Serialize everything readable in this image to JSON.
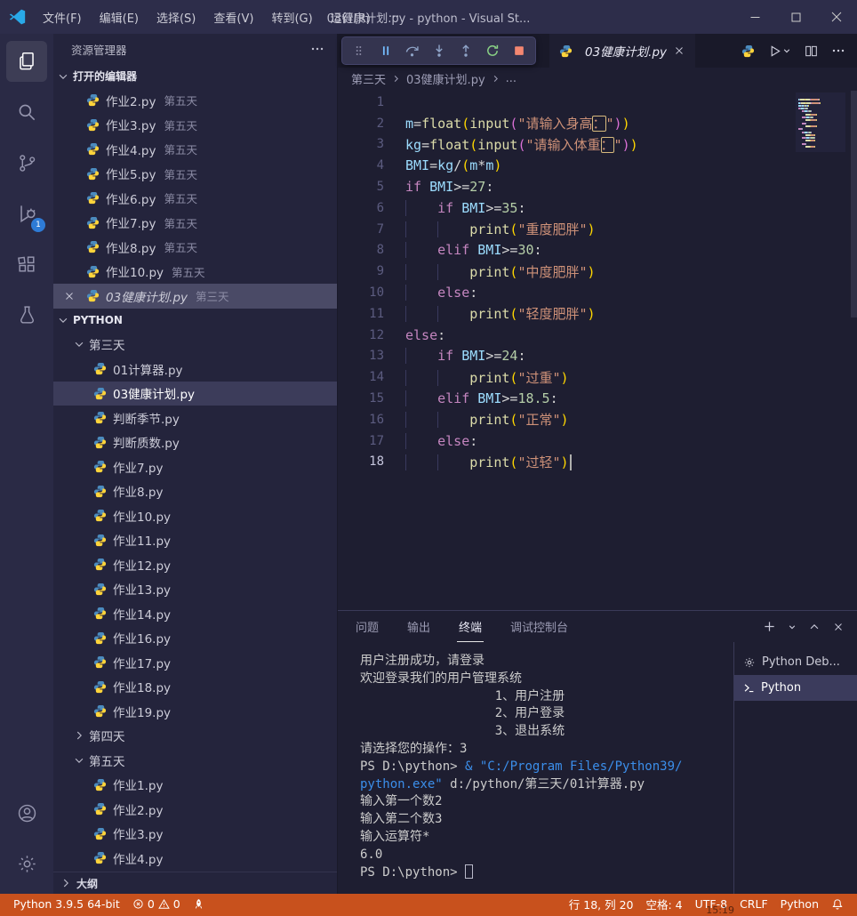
{
  "titlebar": {
    "menus": [
      "文件(F)",
      "编辑(E)",
      "选择(S)",
      "查看(V)",
      "转到(G)",
      "运行(R)",
      "···"
    ],
    "title": "03健康计划.py - python - Visual St..."
  },
  "activity": {
    "debug_badge": "1"
  },
  "sidebar": {
    "header": "资源管理器",
    "open_editors_label": "打开的编辑器",
    "open_editors": [
      {
        "name": "作业2.py",
        "tag": "第五天"
      },
      {
        "name": "作业3.py",
        "tag": "第五天"
      },
      {
        "name": "作业4.py",
        "tag": "第五天"
      },
      {
        "name": "作业5.py",
        "tag": "第五天"
      },
      {
        "name": "作业6.py",
        "tag": "第五天"
      },
      {
        "name": "作业7.py",
        "tag": "第五天"
      },
      {
        "name": "作业8.py",
        "tag": "第五天"
      },
      {
        "name": "作业10.py",
        "tag": "第五天"
      },
      {
        "name": "03健康计划.py",
        "tag": "第三天",
        "active": true
      }
    ],
    "project_label": "PYTHON",
    "tree": [
      {
        "label": "第三天",
        "type": "folder",
        "expanded": true
      },
      {
        "label": "01计算器.py",
        "type": "file"
      },
      {
        "label": "03健康计划.py",
        "type": "file",
        "selected": true
      },
      {
        "label": "判断季节.py",
        "type": "file"
      },
      {
        "label": "判断质数.py",
        "type": "file"
      },
      {
        "label": "作业7.py",
        "type": "file"
      },
      {
        "label": "作业8.py",
        "type": "file"
      },
      {
        "label": "作业10.py",
        "type": "file"
      },
      {
        "label": "作业11.py",
        "type": "file"
      },
      {
        "label": "作业12.py",
        "type": "file"
      },
      {
        "label": "作业13.py",
        "type": "file"
      },
      {
        "label": "作业14.py",
        "type": "file"
      },
      {
        "label": "作业16.py",
        "type": "file"
      },
      {
        "label": "作业17.py",
        "type": "file"
      },
      {
        "label": "作业18.py",
        "type": "file"
      },
      {
        "label": "作业19.py",
        "type": "file"
      },
      {
        "label": "第四天",
        "type": "folder",
        "expanded": false
      },
      {
        "label": "第五天",
        "type": "folder",
        "expanded": true
      },
      {
        "label": "作业1.py",
        "type": "file"
      },
      {
        "label": "作业2.py",
        "type": "file"
      },
      {
        "label": "作业3.py",
        "type": "file"
      },
      {
        "label": "作业4.py",
        "type": "file"
      }
    ],
    "outline_label": "大纲"
  },
  "editor": {
    "tab_label": "03健康计划.py",
    "breadcrumbs": [
      "第三天",
      "03健康计划.py",
      "..."
    ],
    "code_lines": [
      {
        "n": 1,
        "segs": []
      },
      {
        "n": 2,
        "segs": [
          {
            "t": "m",
            "c": "v"
          },
          {
            "t": "=",
            "c": "o"
          },
          {
            "t": "float",
            "c": "f"
          },
          {
            "t": "(",
            "c": "p1"
          },
          {
            "t": "input",
            "c": "f"
          },
          {
            "t": "(",
            "c": "p2"
          },
          {
            "t": "\"请输入身高",
            "c": "s"
          },
          {
            "t": "：",
            "c": "s sbox"
          },
          {
            "t": "\"",
            "c": "s"
          },
          {
            "t": ")",
            "c": "p2"
          },
          {
            "t": ")",
            "c": "p1"
          }
        ]
      },
      {
        "n": 3,
        "segs": [
          {
            "t": "kg",
            "c": "v"
          },
          {
            "t": "=",
            "c": "o"
          },
          {
            "t": "float",
            "c": "f"
          },
          {
            "t": "(",
            "c": "p1"
          },
          {
            "t": "input",
            "c": "f"
          },
          {
            "t": "(",
            "c": "p2"
          },
          {
            "t": "\"请输入体重",
            "c": "s"
          },
          {
            "t": "：",
            "c": "s sbox"
          },
          {
            "t": "\"",
            "c": "s"
          },
          {
            "t": ")",
            "c": "p2"
          },
          {
            "t": ")",
            "c": "p1"
          }
        ]
      },
      {
        "n": 4,
        "segs": [
          {
            "t": "BMI",
            "c": "v"
          },
          {
            "t": "=",
            "c": "o"
          },
          {
            "t": "kg",
            "c": "v"
          },
          {
            "t": "/",
            "c": "o"
          },
          {
            "t": "(",
            "c": "p1"
          },
          {
            "t": "m",
            "c": "v"
          },
          {
            "t": "*",
            "c": "o"
          },
          {
            "t": "m",
            "c": "v"
          },
          {
            "t": ")",
            "c": "p1"
          }
        ]
      },
      {
        "n": 5,
        "segs": [
          {
            "t": "if",
            "c": "k"
          },
          {
            "t": " "
          },
          {
            "t": "BMI",
            "c": "v"
          },
          {
            "t": ">=",
            "c": "o"
          },
          {
            "t": "27",
            "c": "n"
          },
          {
            "t": ":",
            "c": "o"
          }
        ]
      },
      {
        "n": 6,
        "segs": [
          {
            "t": "    ",
            "c": "ind"
          },
          {
            "t": "if",
            "c": "k"
          },
          {
            "t": " "
          },
          {
            "t": "BMI",
            "c": "v"
          },
          {
            "t": ">=",
            "c": "o"
          },
          {
            "t": "35",
            "c": "n"
          },
          {
            "t": ":",
            "c": "o"
          }
        ]
      },
      {
        "n": 7,
        "segs": [
          {
            "t": "    ",
            "c": "ind"
          },
          {
            "t": "    ",
            "c": "ind"
          },
          {
            "t": "print",
            "c": "f"
          },
          {
            "t": "(",
            "c": "p1"
          },
          {
            "t": "\"重度肥胖\"",
            "c": "s"
          },
          {
            "t": ")",
            "c": "p1"
          }
        ]
      },
      {
        "n": 8,
        "segs": [
          {
            "t": "    ",
            "c": "ind"
          },
          {
            "t": "elif",
            "c": "k"
          },
          {
            "t": " "
          },
          {
            "t": "BMI",
            "c": "v"
          },
          {
            "t": ">=",
            "c": "o"
          },
          {
            "t": "30",
            "c": "n"
          },
          {
            "t": ":",
            "c": "o"
          }
        ]
      },
      {
        "n": 9,
        "segs": [
          {
            "t": "    ",
            "c": "ind"
          },
          {
            "t": "    ",
            "c": "ind"
          },
          {
            "t": "print",
            "c": "f"
          },
          {
            "t": "(",
            "c": "p1"
          },
          {
            "t": "\"中度肥胖\"",
            "c": "s"
          },
          {
            "t": ")",
            "c": "p1"
          }
        ]
      },
      {
        "n": 10,
        "segs": [
          {
            "t": "    ",
            "c": "ind"
          },
          {
            "t": "else",
            "c": "k"
          },
          {
            "t": ":",
            "c": "o"
          }
        ]
      },
      {
        "n": 11,
        "segs": [
          {
            "t": "    ",
            "c": "ind"
          },
          {
            "t": "    ",
            "c": "ind"
          },
          {
            "t": "print",
            "c": "f"
          },
          {
            "t": "(",
            "c": "p1"
          },
          {
            "t": "\"轻度肥胖\"",
            "c": "s"
          },
          {
            "t": ")",
            "c": "p1"
          }
        ]
      },
      {
        "n": 12,
        "segs": [
          {
            "t": "else",
            "c": "k"
          },
          {
            "t": ":",
            "c": "o"
          }
        ]
      },
      {
        "n": 13,
        "segs": [
          {
            "t": "    ",
            "c": "ind"
          },
          {
            "t": "if",
            "c": "k"
          },
          {
            "t": " "
          },
          {
            "t": "BMI",
            "c": "v"
          },
          {
            "t": ">=",
            "c": "o"
          },
          {
            "t": "24",
            "c": "n"
          },
          {
            "t": ":",
            "c": "o"
          }
        ]
      },
      {
        "n": 14,
        "segs": [
          {
            "t": "    ",
            "c": "ind"
          },
          {
            "t": "    ",
            "c": "ind"
          },
          {
            "t": "print",
            "c": "f"
          },
          {
            "t": "(",
            "c": "p1"
          },
          {
            "t": "\"过重\"",
            "c": "s"
          },
          {
            "t": ")",
            "c": "p1"
          }
        ]
      },
      {
        "n": 15,
        "segs": [
          {
            "t": "    ",
            "c": "ind"
          },
          {
            "t": "elif",
            "c": "k"
          },
          {
            "t": " "
          },
          {
            "t": "BMI",
            "c": "v"
          },
          {
            "t": ">=",
            "c": "o"
          },
          {
            "t": "18.5",
            "c": "n"
          },
          {
            "t": ":",
            "c": "o"
          }
        ]
      },
      {
        "n": 16,
        "segs": [
          {
            "t": "    ",
            "c": "ind"
          },
          {
            "t": "    ",
            "c": "ind"
          },
          {
            "t": "print",
            "c": "f"
          },
          {
            "t": "(",
            "c": "p1"
          },
          {
            "t": "\"正常\"",
            "c": "s"
          },
          {
            "t": ")",
            "c": "p1"
          }
        ]
      },
      {
        "n": 17,
        "segs": [
          {
            "t": "    ",
            "c": "ind"
          },
          {
            "t": "else",
            "c": "k"
          },
          {
            "t": ":",
            "c": "o"
          }
        ]
      },
      {
        "n": 18,
        "segs": [
          {
            "t": "    ",
            "c": "ind"
          },
          {
            "t": "    ",
            "c": "ind"
          },
          {
            "t": "print",
            "c": "f"
          },
          {
            "t": "(",
            "c": "p1"
          },
          {
            "t": "\"过轻\"",
            "c": "s"
          },
          {
            "t": ")",
            "c": "p1"
          }
        ],
        "active": true,
        "cursor": true
      }
    ]
  },
  "panel": {
    "tabs": [
      {
        "label": "问题"
      },
      {
        "label": "输出"
      },
      {
        "label": "终端",
        "active": true
      },
      {
        "label": "调试控制台"
      }
    ],
    "terminal_lines": [
      {
        "segs": [
          {
            "t": "用户注册成功，请登录"
          }
        ]
      },
      {
        "segs": [
          {
            "t": "欢迎登录我们的用户管理系统"
          }
        ]
      },
      {
        "segs": [
          {
            "t": "                  1、用户注册"
          }
        ]
      },
      {
        "segs": [
          {
            "t": "                  2、用户登录"
          }
        ]
      },
      {
        "segs": [
          {
            "t": "                  3、退出系统"
          }
        ]
      },
      {
        "segs": [
          {
            "t": "请选择您的操作：3"
          }
        ]
      },
      {
        "segs": [
          {
            "t": "PS D:\\python> "
          },
          {
            "t": "& \"C:/Program Files/Python39/",
            "c": "cmd"
          }
        ]
      },
      {
        "segs": [
          {
            "t": "python.exe\"",
            "c": "cmd"
          },
          {
            "t": " d:/python/第三天/01计算器.py"
          }
        ]
      },
      {
        "segs": [
          {
            "t": "输入第一个数2"
          }
        ]
      },
      {
        "segs": [
          {
            "t": "输入第二个数3"
          }
        ]
      },
      {
        "segs": [
          {
            "t": "输入运算符*"
          }
        ]
      },
      {
        "segs": [
          {
            "t": "6.0"
          }
        ]
      },
      {
        "segs": [
          {
            "t": "PS D:\\python> "
          }
        ],
        "cursor": true
      }
    ],
    "terminal_list": [
      {
        "label": "Python Deb...",
        "icon": "gear"
      },
      {
        "label": "Python",
        "icon": "prompt",
        "selected": true
      }
    ]
  },
  "statusbar": {
    "interpreter": "Python 3.9.5 64-bit",
    "errors": "0",
    "warnings": "0",
    "right": [
      "行 18, 列 20",
      "空格: 4",
      "UTF-8",
      "CRLF",
      "Python"
    ],
    "clock": "15:19"
  }
}
